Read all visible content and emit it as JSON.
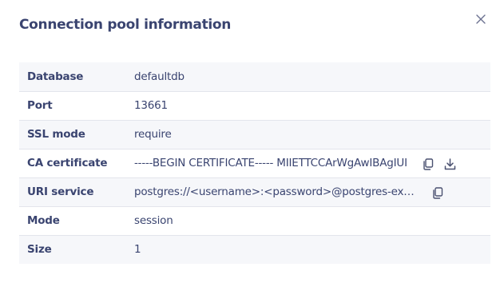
{
  "dialog": {
    "title": "Connection pool information"
  },
  "rows": [
    {
      "label": "Database",
      "value": "defaultdb"
    },
    {
      "label": "Port",
      "value": "13661"
    },
    {
      "label": "SSL mode",
      "value": "require"
    },
    {
      "label": "CA certificate",
      "value": "-----BEGIN CERTIFICATE----- MIIETTCCArWgAwIBAgIUI"
    },
    {
      "label": "URI service",
      "value": "postgres://<username>:<password>@postgres-example.aivencloud.com"
    },
    {
      "label": "Mode",
      "value": "session"
    },
    {
      "label": "Size",
      "value": "1"
    }
  ],
  "icons": {
    "close": "close-icon",
    "copy": "copy-icon",
    "download": "download-icon"
  },
  "colors": {
    "text": "#3a4470",
    "icon": "#6b7190",
    "row_shade": "#f6f7fa",
    "divider": "#e3e5ec"
  }
}
